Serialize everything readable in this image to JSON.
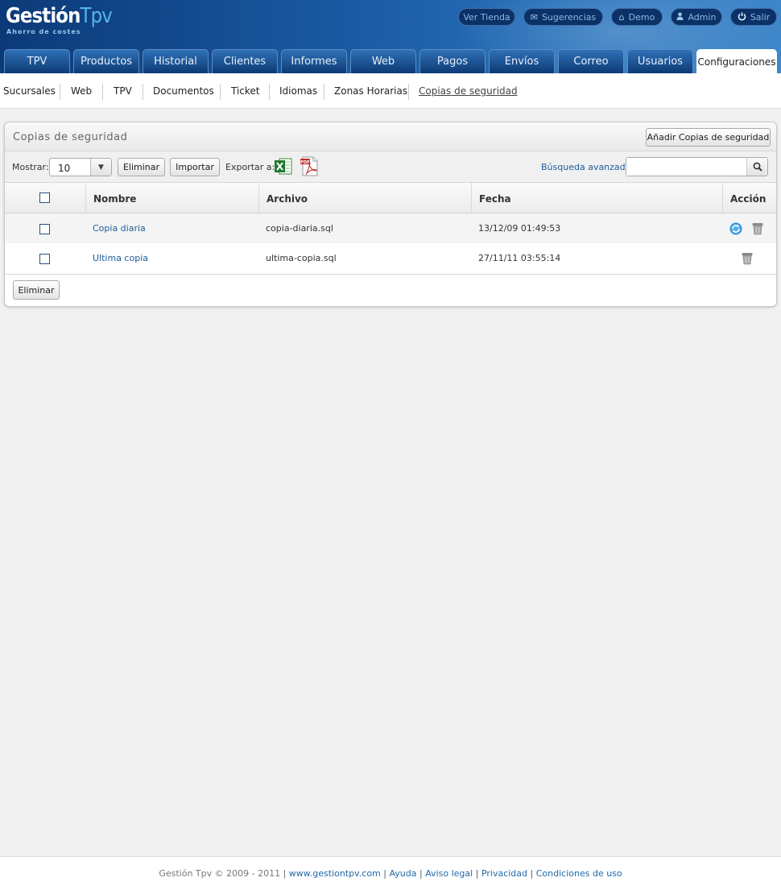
{
  "app": {
    "logo_main": "Gestión",
    "logo_accent": "Tpv",
    "logo_tagline": "Ahorro de costes"
  },
  "top_links": [
    {
      "label": "Ver Tienda",
      "icon": "none"
    },
    {
      "label": "Sugerencias",
      "icon": "envelope-icon"
    },
    {
      "label": "Demo",
      "icon": "home-icon"
    },
    {
      "label": "Admin",
      "icon": "user-icon"
    },
    {
      "label": "Salir",
      "icon": "power-icon"
    }
  ],
  "tabs": [
    {
      "label": "TPV"
    },
    {
      "label": "Productos"
    },
    {
      "label": "Historial"
    },
    {
      "label": "Clientes"
    },
    {
      "label": "Informes"
    },
    {
      "label": "Web"
    },
    {
      "label": "Pagos"
    },
    {
      "label": "Envíos"
    },
    {
      "label": "Correo"
    },
    {
      "label": "Usuarios"
    },
    {
      "label": "Configuraciones",
      "active": true
    }
  ],
  "subnav": [
    {
      "label": "Sucursales"
    },
    {
      "label": "Web"
    },
    {
      "label": "TPV"
    },
    {
      "label": "Documentos"
    },
    {
      "label": "Ticket"
    },
    {
      "label": "Idiomas"
    },
    {
      "label": "Zonas Horarias"
    },
    {
      "label": "Copias de seguridad",
      "active": true
    }
  ],
  "panel": {
    "title": "Copias de seguridad",
    "add_button": "Añadir Copias de seguridad"
  },
  "toolbar": {
    "show_label": "Mostrar:",
    "show_value": "10",
    "delete_button": "Eliminar",
    "import_button": "Importar",
    "export_label": "Exportar a:",
    "advanced_search": "Búsqueda avanzada",
    "search_value": ""
  },
  "table": {
    "columns": [
      "Nombre",
      "Archivo",
      "Fecha",
      "Acción"
    ],
    "rows": [
      {
        "nombre": "Copia diaria",
        "archivo": "copia-diaria.sql",
        "fecha": "13/12/09 01:49:53",
        "actions": [
          "restore-icon",
          "trash-icon"
        ]
      },
      {
        "nombre": "Ultima copia",
        "archivo": "ultima-copia.sql",
        "fecha": "27/11/11 03:55:14",
        "actions": [
          "trash-icon"
        ]
      }
    ]
  },
  "bottom": {
    "delete_button": "Eliminar"
  },
  "footer": {
    "copyright": "Gestión Tpv © 2009 - 2011 |",
    "links": [
      "www.gestiontpv.com",
      "Ayuda",
      "Aviso legal",
      "Privacidad",
      "Condiciones de uso"
    ],
    "separator": "|"
  },
  "colors": {
    "header_dark": "#0c3a78",
    "header_light": "#3d86c9",
    "link": "#1e5d9a",
    "excel": "#1f7a2f",
    "pdf": "#c62828"
  }
}
